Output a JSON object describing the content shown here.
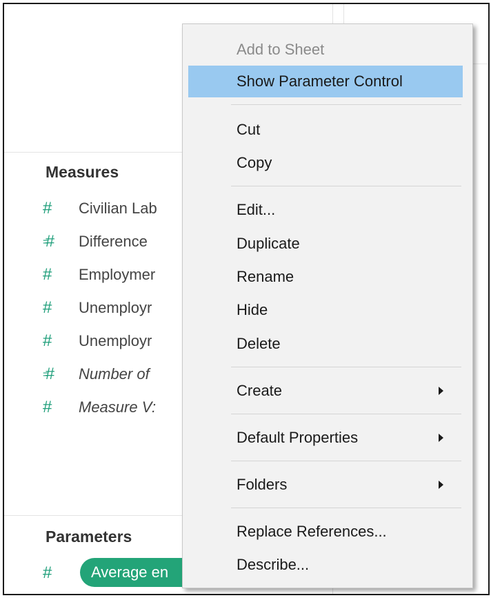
{
  "data_pane": {
    "measures_title": "Measures",
    "measures": [
      {
        "name": "Civilian Lab",
        "italic": false,
        "calc": false
      },
      {
        "name": "Difference ",
        "italic": false,
        "calc": true
      },
      {
        "name": "Employmer",
        "italic": false,
        "calc": false
      },
      {
        "name": "Unemployr",
        "italic": false,
        "calc": false
      },
      {
        "name": "Unemployr",
        "italic": false,
        "calc": false
      },
      {
        "name": "Number of",
        "italic": true,
        "calc": true
      },
      {
        "name": "Measure V:",
        "italic": true,
        "calc": false
      }
    ],
    "parameters_title": "Parameters",
    "parameter_pill": "Average en",
    "hash_glyph": "#",
    "calc_glyph": "="
  },
  "context_menu": {
    "items": [
      {
        "label": "Add to Sheet",
        "state": "disabled",
        "submenu": false
      },
      {
        "label": "Show Parameter Control",
        "state": "highlight",
        "submenu": false
      },
      {
        "label": "Cut",
        "state": "normal",
        "submenu": false
      },
      {
        "label": "Copy",
        "state": "normal",
        "submenu": false
      },
      {
        "label": "Edit...",
        "state": "normal",
        "submenu": false
      },
      {
        "label": "Duplicate",
        "state": "normal",
        "submenu": false
      },
      {
        "label": "Rename",
        "state": "normal",
        "submenu": false
      },
      {
        "label": "Hide",
        "state": "normal",
        "submenu": false
      },
      {
        "label": "Delete",
        "state": "normal",
        "submenu": false
      },
      {
        "label": "Create",
        "state": "normal",
        "submenu": true
      },
      {
        "label": "Default Properties",
        "state": "normal",
        "submenu": true
      },
      {
        "label": "Folders",
        "state": "normal",
        "submenu": true
      },
      {
        "label": "Replace References...",
        "state": "normal",
        "submenu": false
      },
      {
        "label": "Describe...",
        "state": "normal",
        "submenu": false
      }
    ]
  },
  "colors": {
    "field_icon": "#1e9e7a",
    "pill_bg": "#23a478",
    "menu_bg": "#f2f2f2",
    "menu_highlight": "#99c9f0",
    "disabled_text": "#8a8a8a"
  }
}
